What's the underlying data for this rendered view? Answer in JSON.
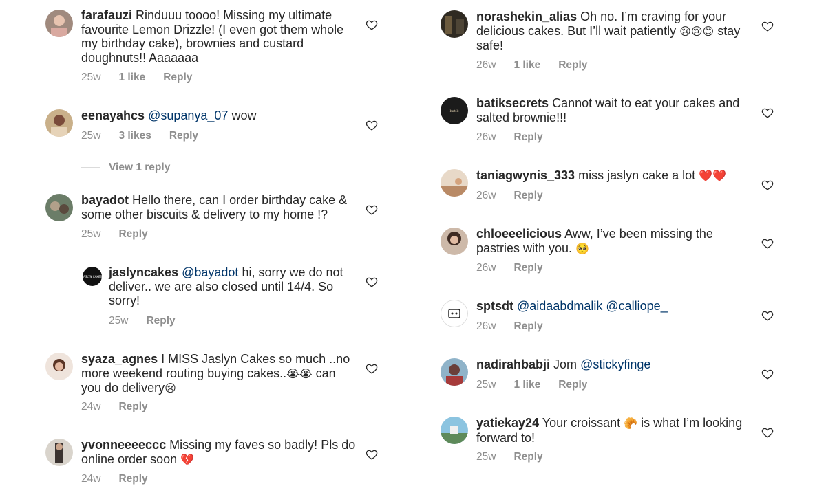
{
  "colors": {
    "text": "#262626",
    "muted": "#8e8e8e",
    "mention": "#003569",
    "divider": "#dbdbdb",
    "emoji_heart": "#ed4956"
  },
  "left_comments": [
    {
      "username": "farafauzi",
      "text": "Rinduuu toooo! Missing my ultimate favourite Lemon Drizzle! (I even got them whole my birthday cake), brownies and custard doughnuts!! Aaaaaaa",
      "time": "25w",
      "likes": "1 like",
      "reply": "Reply"
    },
    {
      "username": "eenayahcs",
      "mention": "@supanya_07",
      "text": "wow",
      "time": "25w",
      "likes": "3 likes",
      "reply": "Reply",
      "view_replies": "View 1 reply"
    },
    {
      "username": "bayadot",
      "text": "Hello there, can I order birthday cake & some other biscuits & delivery to my home !?",
      "time": "25w",
      "reply": "Reply"
    },
    {
      "username": "jaslyncakes",
      "mention": "@bayadot",
      "text": "hi, sorry we do not deliver.. we are also closed until 14/4. So sorry!",
      "time": "25w",
      "reply": "Reply"
    },
    {
      "username": "syaza_agnes",
      "text_a": "I MISS Jaslyn Cakes so much ..no more weekend routing buying cakes..",
      "emoji_a": "😭😭",
      "text_b": "can you do delivery",
      "emoji_b": "😢",
      "time": "24w",
      "reply": "Reply"
    },
    {
      "username": "yvonneeeeccc",
      "text": "Missing my faves so badly! Pls do online order soon",
      "emoji": "💔",
      "time": "24w",
      "reply": "Reply"
    }
  ],
  "right_comments": [
    {
      "username": "norashekin_alias",
      "text": "Oh no. I’m craving for your delicious cakes.  But I’ll wait patiently",
      "emoji": "😢😢😊",
      "text_b": "stay safe!",
      "time": "26w",
      "likes": "1 like",
      "reply": "Reply"
    },
    {
      "username": "batiksecrets",
      "text": "Cannot wait to eat your cakes and salted brownie!!!",
      "time": "26w",
      "reply": "Reply"
    },
    {
      "username": "taniagwynis_333",
      "text": "miss jaslyn cake a lot",
      "emoji": "❤️❤️",
      "time": "26w",
      "reply": "Reply"
    },
    {
      "username": "chloeeelicious",
      "text": "Aww, I’ve been missing the pastries with you.",
      "emoji": "🥺",
      "time": "26w",
      "reply": "Reply"
    },
    {
      "username": "sptsdt",
      "mention_a": "@aidaabdmalik",
      "mention_b": "@calliope_",
      "time": "26w",
      "reply": "Reply"
    },
    {
      "username": "nadirahbabji",
      "text": "Jom",
      "mention": "@stickyfinge",
      "time": "25w",
      "likes": "1 like",
      "reply": "Reply"
    },
    {
      "username": "yatiekay24",
      "text_a": "Your croissant",
      "emoji": "🥐",
      "text_b": "is what I’m looking forward to!",
      "time": "25w",
      "reply": "Reply"
    }
  ]
}
